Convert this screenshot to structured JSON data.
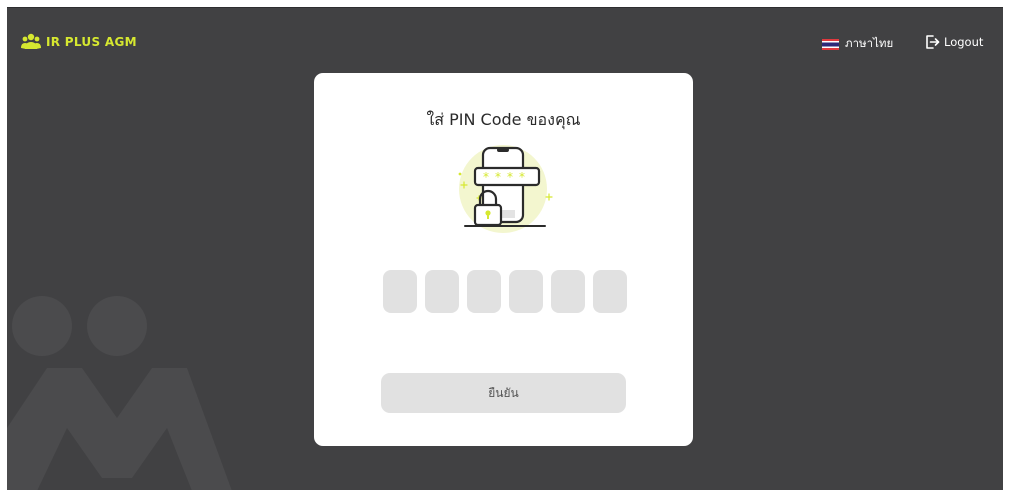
{
  "colors": {
    "background": "#414143",
    "brand_accent": "#d6e830",
    "card": "#ffffff",
    "input_fill": "#e1e1e1"
  },
  "header": {
    "brand_text": "IR PLUS AGM",
    "brand_icon": "users-group-icon",
    "language_label": "ภาษาไทย",
    "language_icon": "thai-flag-icon",
    "logout_label": "Logout",
    "logout_icon": "logout-icon"
  },
  "pin_card": {
    "title": "ใส่ PIN Code ของคุณ",
    "illustration": "phone-lock-password-icon",
    "pin_slots": [
      {
        "value": ""
      },
      {
        "value": ""
      },
      {
        "value": ""
      },
      {
        "value": ""
      },
      {
        "value": ""
      },
      {
        "value": ""
      }
    ],
    "confirm_label": "ยืนยัน"
  }
}
